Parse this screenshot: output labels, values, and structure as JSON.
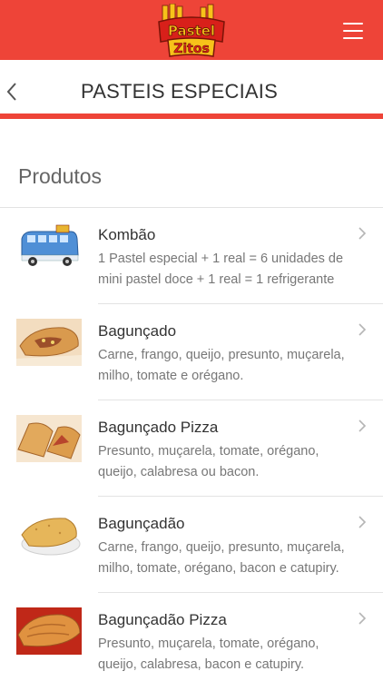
{
  "header": {
    "logo_line1": "Pastel",
    "logo_line2": "Zitos",
    "menu_icon": "hamburger-icon",
    "brand_color": "#ee4438"
  },
  "titlebar": {
    "back_icon": "chevron-left-icon",
    "title": "PASTEIS ESPECIAIS"
  },
  "section": {
    "title": "Produtos"
  },
  "products": [
    {
      "name": "Kombão",
      "description": "1 Pastel especial + 1 real = 6 unidades de mini pastel doce + 1 real = 1 refrigerante",
      "thumbnail": "kombi-van-image"
    },
    {
      "name": "Bagunçado",
      "description": "Carne, frango, queijo, presunto, muçarela, milho, tomate e orégano.",
      "thumbnail": "pastel-image"
    },
    {
      "name": "Bagunçado Pizza",
      "description": "Presunto, muçarela, tomate, orégano, queijo, calabresa ou bacon.",
      "thumbnail": "pastel-image"
    },
    {
      "name": "Bagunçadão",
      "description": "Carne, frango, queijo, presunto, muçarela, milho, tomate, orégano, bacon e catupiry.",
      "thumbnail": "pastel-plate-image"
    },
    {
      "name": "Bagunçadão Pizza",
      "description": "Presunto, muçarela, tomate, orégano, queijo, calabresa, bacon e catupiry.",
      "thumbnail": "pastel-image"
    }
  ]
}
